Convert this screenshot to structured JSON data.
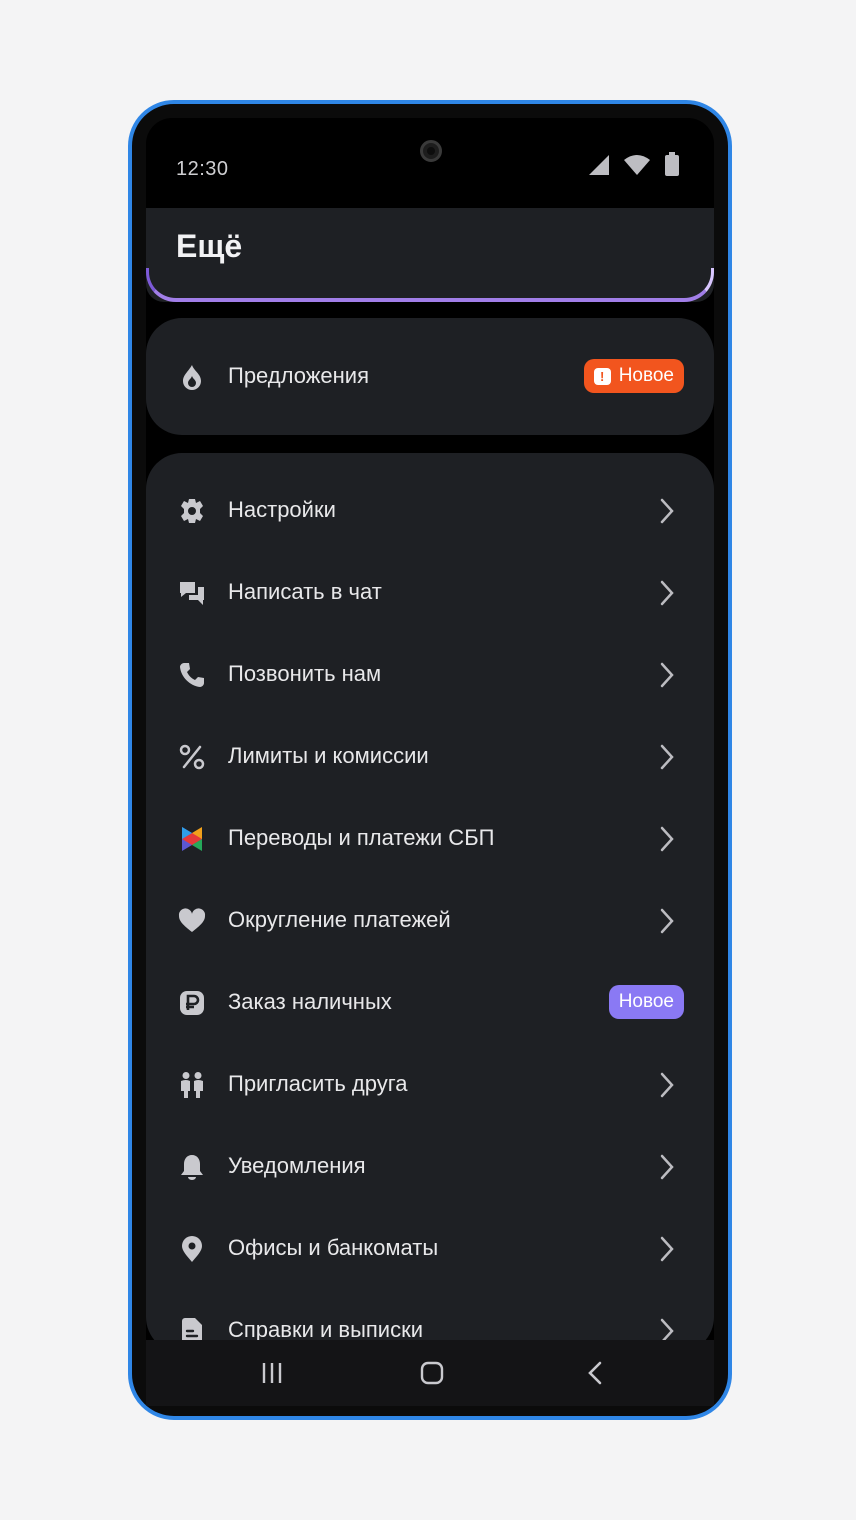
{
  "status_bar": {
    "time": "12:30"
  },
  "header": {
    "title": "Ещё"
  },
  "offers": {
    "label": "Предложения",
    "badge": "Новое"
  },
  "menu": [
    {
      "label": "Настройки",
      "icon": "gear-icon"
    },
    {
      "label": "Написать в чат",
      "icon": "chat-icon"
    },
    {
      "label": "Позвонить нам",
      "icon": "phone-icon"
    },
    {
      "label": "Лимиты и комиссии",
      "icon": "percent-icon"
    },
    {
      "label": "Переводы и платежи СБП",
      "icon": "sbp-icon"
    },
    {
      "label": "Округление платежей",
      "icon": "heart-icon"
    },
    {
      "label": "Заказ наличных",
      "icon": "ruble-icon",
      "badge": "Новое"
    },
    {
      "label": "Пригласить друга",
      "icon": "friends-icon"
    },
    {
      "label": "Уведомления",
      "icon": "bell-icon"
    },
    {
      "label": "Офисы и банкоматы",
      "icon": "location-pin-icon"
    },
    {
      "label": "Справки и выписки",
      "icon": "document-icon"
    }
  ],
  "colors": {
    "accent_orange": "#f2551e",
    "accent_purple": "#8a79f4",
    "phone_frame": "#2f86e6",
    "card_bg": "#1e2024"
  }
}
